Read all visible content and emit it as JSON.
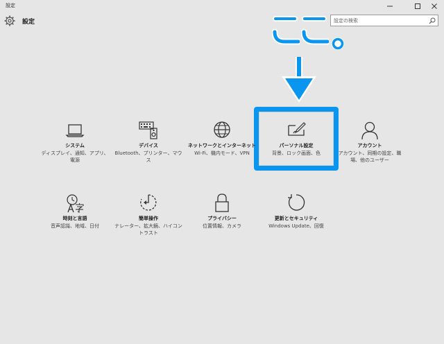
{
  "window": {
    "title": "設定",
    "minimize_label": "—",
    "maximize_label": "□",
    "close_label": "✕"
  },
  "header": {
    "icon": "gear-icon",
    "title": "設定"
  },
  "search": {
    "placeholder": "設定の検索",
    "value": "",
    "icon": "search-icon"
  },
  "annotation": {
    "text": "ここ。",
    "color": "#0a96ef"
  },
  "accent_color": "#0a96ef",
  "tiles": [
    {
      "name": "システム",
      "desc": "ディスプレイ、通知、アプリ、電源",
      "icon": "laptop-icon"
    },
    {
      "name": "デバイス",
      "desc": "Bluetooth、プリンター、マウス",
      "icon": "keyboard-printer-icon"
    },
    {
      "name": "ネットワークとインターネット",
      "desc": "Wi-Fi、機内モード、VPN",
      "icon": "globe-icon"
    },
    {
      "name": "パーソナル設定",
      "desc": "背景、ロック画面、色",
      "icon": "paint-brush-monitor-icon"
    },
    {
      "name": "アカウント",
      "desc": "アカウント、同期の設定、職場、他のユーザー",
      "icon": "person-icon"
    },
    {
      "name": "時刻と言語",
      "desc": "音声認識、地域、日付",
      "icon": "time-language-icon"
    },
    {
      "name": "簡単操作",
      "desc": "ナレーター、拡大鏡、ハイコントラスト",
      "icon": "ease-of-access-icon"
    },
    {
      "name": "プライバシー",
      "desc": "位置情報、カメラ",
      "icon": "lock-icon"
    },
    {
      "name": "更新とセキュリティ",
      "desc": "Windows Update、回復",
      "icon": "refresh-icon"
    }
  ]
}
